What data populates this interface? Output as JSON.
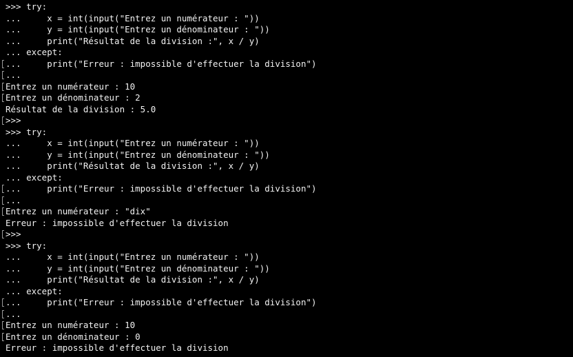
{
  "terminal": {
    "lines": [
      {
        "text": ">>> try:",
        "mark": false
      },
      {
        "text": "...     x = int(input(\"Entrez un numérateur : \"))",
        "mark": false
      },
      {
        "text": "...     y = int(input(\"Entrez un dénominateur : \"))",
        "mark": false
      },
      {
        "text": "...     print(\"Résultat de la division :\", x / y)",
        "mark": false
      },
      {
        "text": "... except:",
        "mark": false
      },
      {
        "text": "...     print(\"Erreur : impossible d'effectuer la division\")",
        "mark": true
      },
      {
        "text": "...",
        "mark": true
      },
      {
        "text": "Entrez un numérateur : 10",
        "mark": true
      },
      {
        "text": "Entrez un dénominateur : 2",
        "mark": true
      },
      {
        "text": "Résultat de la division : 5.0",
        "mark": false
      },
      {
        "text": ">>>",
        "mark": true
      },
      {
        "text": ">>> try:",
        "mark": false
      },
      {
        "text": "...     x = int(input(\"Entrez un numérateur : \"))",
        "mark": false
      },
      {
        "text": "...     y = int(input(\"Entrez un dénominateur : \"))",
        "mark": false
      },
      {
        "text": "...     print(\"Résultat de la division :\", x / y)",
        "mark": false
      },
      {
        "text": "... except:",
        "mark": false
      },
      {
        "text": "...     print(\"Erreur : impossible d'effectuer la division\")",
        "mark": true
      },
      {
        "text": "...",
        "mark": true
      },
      {
        "text": "Entrez un numérateur : \"dix\"",
        "mark": true
      },
      {
        "text": "Erreur : impossible d'effectuer la division",
        "mark": false
      },
      {
        "text": ">>>",
        "mark": true
      },
      {
        "text": ">>> try:",
        "mark": false
      },
      {
        "text": "...     x = int(input(\"Entrez un numérateur : \"))",
        "mark": false
      },
      {
        "text": "...     y = int(input(\"Entrez un dénominateur : \"))",
        "mark": false
      },
      {
        "text": "...     print(\"Résultat de la division :\", x / y)",
        "mark": false
      },
      {
        "text": "... except:",
        "mark": false
      },
      {
        "text": "...     print(\"Erreur : impossible d'effectuer la division\")",
        "mark": true
      },
      {
        "text": "...",
        "mark": true
      },
      {
        "text": "Entrez un numérateur : 10",
        "mark": true
      },
      {
        "text": "Entrez un dénominateur : 0",
        "mark": true
      },
      {
        "text": "Erreur : impossible d'effectuer la division",
        "mark": false
      }
    ]
  }
}
